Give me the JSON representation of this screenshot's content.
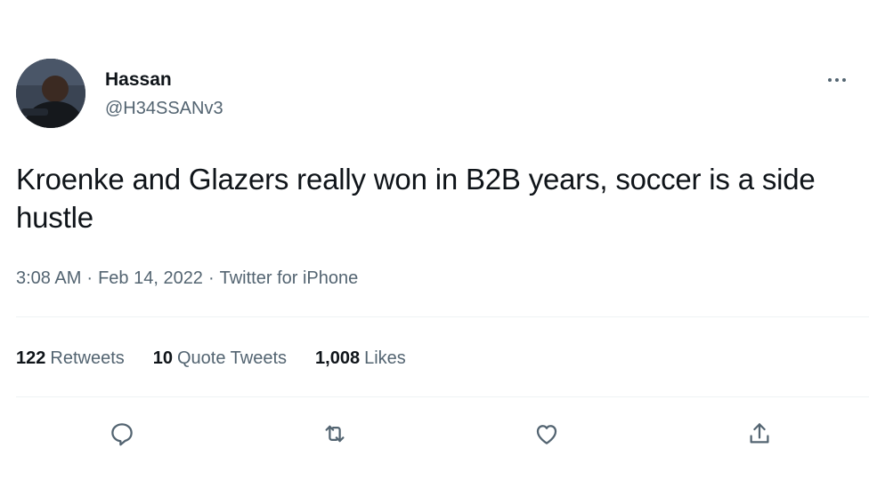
{
  "tweet": {
    "display_name": "Hassan",
    "handle": "@H34SSANv3",
    "text": "Kroenke and Glazers really won in B2B years, soccer is a side hustle",
    "time": "3:08 AM",
    "date": "Feb 14, 2022",
    "source": "Twitter for iPhone",
    "separator": "·"
  },
  "stats": {
    "retweets_count": "122",
    "retweets_label": "Retweets",
    "quote_count": "10",
    "quote_label": "Quote Tweets",
    "likes_count": "1,008",
    "likes_label": "Likes"
  },
  "icons": {
    "more": "more-horizontal-icon",
    "reply": "reply-icon",
    "retweet": "retweet-icon",
    "like": "heart-icon",
    "share": "share-icon"
  },
  "colors": {
    "text_primary": "#0f1419",
    "text_secondary": "#536471",
    "divider": "#eff3f4"
  }
}
